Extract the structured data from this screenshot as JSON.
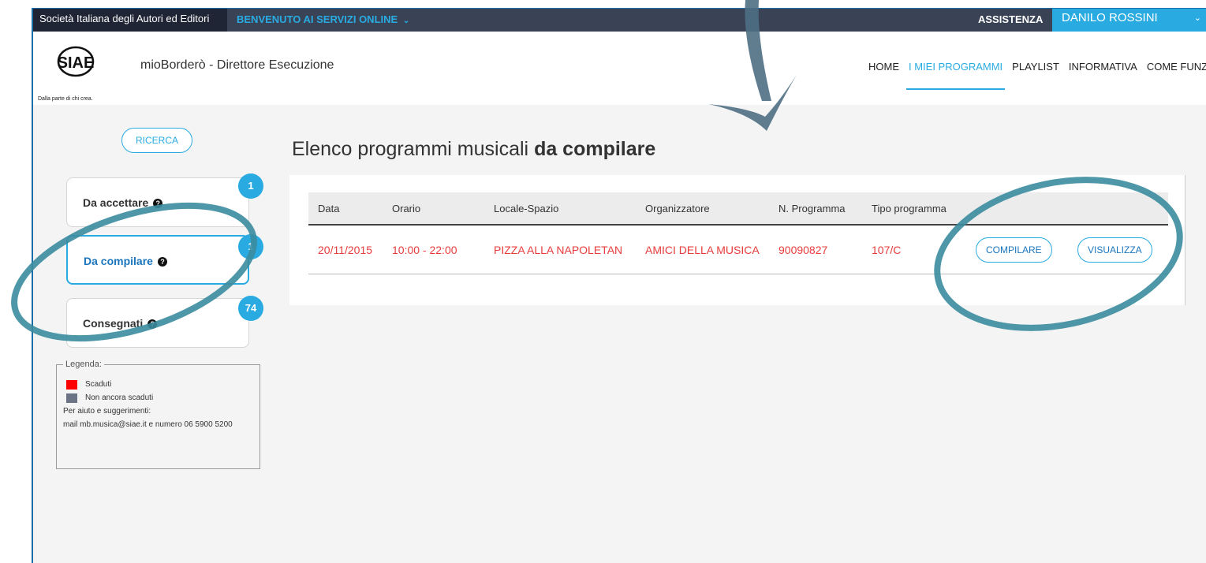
{
  "topbar": {
    "org_name": "Società Italiana degli Autori ed Editori",
    "welcome": "BENVENUTO AI SERVIZI ONLINE",
    "assist": "ASSISTENZA",
    "user": "DANILO ROSSINI"
  },
  "header": {
    "logo_text": "SIAE",
    "logo_tag": "Dalla parte di chi crea.",
    "app_title": "mioBorderò - Direttore Esecuzione",
    "nav": [
      "HOME",
      "I MIEI PROGRAMMI",
      "PLAYLIST",
      "INFORMATIVA",
      "COME FUNZIONA"
    ]
  },
  "sidebar": {
    "search_label": "RICERCA",
    "tabs": [
      {
        "label": "Da accettare",
        "badge": "1"
      },
      {
        "label": "Da compilare",
        "badge": "1"
      },
      {
        "label": "Consegnati",
        "badge": "74"
      }
    ],
    "legend": {
      "title": "Legenda:",
      "expired": "Scaduti",
      "not_expired": "Non ancora scaduti",
      "help_title": "Per aiuto e suggerimenti:",
      "help_text": "mail mb.musica@siae.it e numero 06 5900 5200"
    }
  },
  "main": {
    "title_prefix": "Elenco programmi musicali",
    "title_bold": "da compilare",
    "columns": [
      "Data",
      "Orario",
      "Locale-Spazio",
      "Organizzatore",
      "N. Programma",
      "Tipo programma"
    ],
    "row": {
      "data": "20/11/2015",
      "orario": "10:00 - 22:00",
      "locale": "PIZZA ALLA NAPOLETAN",
      "organizzatore": "AMICI DELLA MUSICA",
      "numero": "90090827",
      "tipo": "107/C"
    },
    "compile_label": "COMPILARE",
    "view_label": "VISUALIZZA"
  },
  "colors": {
    "accent": "#29abe2",
    "topbar": "#3a4256",
    "expired": "#ff0000",
    "not_expired": "#6b7385",
    "row_text": "#e83c3c"
  }
}
